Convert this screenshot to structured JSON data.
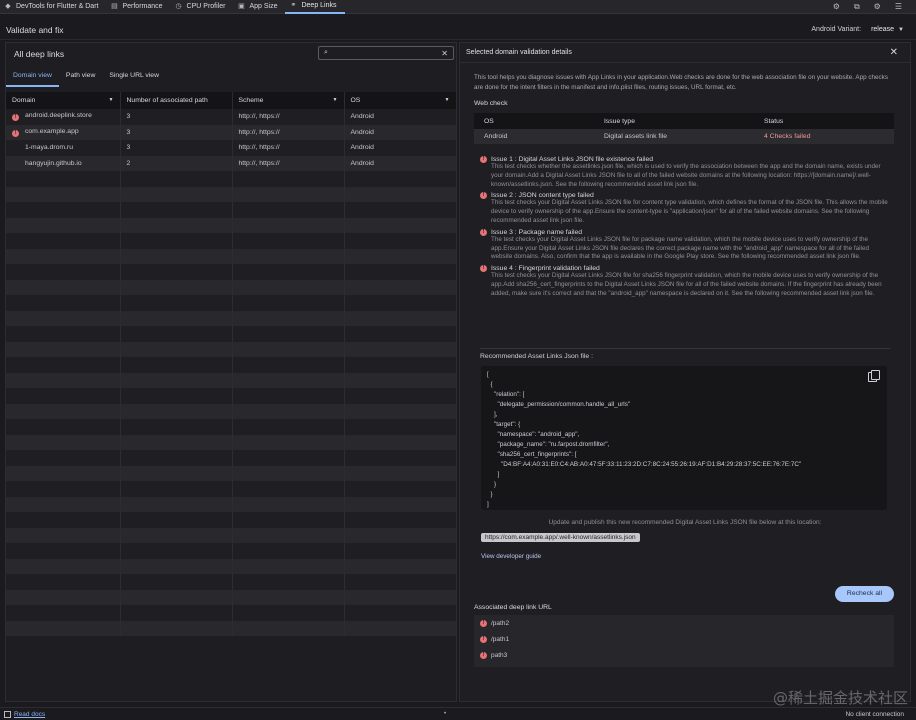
{
  "tabs": [
    {
      "label": "DevTools for Flutter & Dart",
      "icon": "devtools-icon"
    },
    {
      "label": "Performance",
      "icon": "performance-icon"
    },
    {
      "label": "CPU Profiler",
      "icon": "cpu-profiler-icon"
    },
    {
      "label": "App Size",
      "icon": "app-size-icon"
    },
    {
      "label": "Deep Links",
      "icon": "link-icon"
    }
  ],
  "header": {
    "title": "Validate and fix",
    "variant_label": "Android Variant:",
    "variant_value": "release"
  },
  "left": {
    "title": "All deep links",
    "search_value": "",
    "subtabs": [
      "Domain view",
      "Path view",
      "Single URL view"
    ],
    "columns": [
      "Domain",
      "Number of associated path",
      "Scheme",
      "OS"
    ],
    "rows": [
      {
        "error": true,
        "domain": "android.deeplink.store",
        "count": "3",
        "scheme": "http://, https://",
        "os": "Android"
      },
      {
        "error": true,
        "domain": "com.example.app",
        "count": "3",
        "scheme": "http://, https://",
        "os": "Android"
      },
      {
        "error": false,
        "domain": "1-maya.drom.ru",
        "count": "3",
        "scheme": "http://, https://",
        "os": "Android"
      },
      {
        "error": false,
        "domain": "hangyujin.github.io",
        "count": "2",
        "scheme": "http://, https://",
        "os": "Android"
      }
    ]
  },
  "right": {
    "title": "Selected domain validation details",
    "description": "This tool helps you diagnose issues with App Links in your application.Web checks are done for the web association file on your website. App checks are done for the intent filters in the manifest and info.plist files, routing issues, URL format, etc.",
    "web_check_label": "Web check",
    "web_columns": [
      "OS",
      "Issue type",
      "Status"
    ],
    "web_row": {
      "os": "Android",
      "issue_type": "Digital assets link file",
      "status": "4 Checks failed"
    },
    "issues": [
      {
        "title": "Issue 1 : Digital Asset Links JSON file existence failed",
        "body": "This test checks whether the assetlinks.json file, which is used to verify the association between the app and the domain name, exists under your domain.Add a Digital Asset Links JSON file to all of the failed website domains at the following location: https://[domain.name]/.well-known/assetlinks.json. See the following recommended asset link json file."
      },
      {
        "title": "Issue 2 : JSON content type failed",
        "body": "This test checks your Digital Asset Links JSON file for content type validation, which defines the format of the JSON file. This allows the mobile device to verify ownership of the app.Ensure the content-type is \"application/json\" for all of the failed website domains. See the following recommended asset link json file."
      },
      {
        "title": "Issue 3 : Package name failed",
        "body": "The test checks your Digital Asset Links JSON file for package name validation, which the mobile device uses to verify ownership of the app.Ensure your Digital Asset Links JSON file declares the correct package name with the \"android_app\" namespace for all of the failed website domains. Also, confirm that the app is available in the Google Play store. See the following recommended asset link json file."
      },
      {
        "title": "Issue 4 : Fingerprint validation failed",
        "body": "This test checks your Digital Asset Links JSON file for sha256 fingerprint validation, which the mobile device uses to verify ownership of the app.Add sha256_cert_fingerprints to the Digital Asset Links JSON file for all of the failed website domains. If the fingerprint has already been added, make sure it's correct and that the \"android_app\" namespace is declared on it. See the following recommended asset link json file."
      }
    ],
    "recommended_label": "Recommended Asset Links Json file :",
    "json_lines": [
      "[",
      "  {",
      "    \"relation\": [",
      "      \"delegate_permission/common.handle_all_urls\"",
      "    ],",
      "    \"target\": {",
      "      \"namespace\": \"android_app\",",
      "      \"package_name\": \"ru.farpost.dromfilter\",",
      "      \"sha256_cert_fingerprints\": [",
      "        \"D4:BF:A4:A0:31:E0:C4:AB:A0:47:5F:33:11:23:2D:C7:8C:24:55:26:19:AF:D1:B4:29:28:37:5C:EE:76:7E:7C\"",
      "      ]",
      "    }",
      "  }",
      "]"
    ],
    "update_text": "Update and publish this new recommended Digital Asset Links JSON file below at this location:",
    "url_chip": "https://com.example.app/.well-known/assetlinks.json",
    "developer_guide": "View developer guide",
    "recheck_label": "Recheck all",
    "associated_label": "Associated deep link URL",
    "associated_paths": [
      "/path2",
      "/path1",
      "path3"
    ]
  },
  "footer": {
    "docs": "Read docs",
    "status": "No client connection"
  },
  "watermark": "@稀土掘金技术社区",
  "colors": {
    "accent": "#8ab4f8",
    "error": "#e57373",
    "button": "#a8c7fa"
  }
}
